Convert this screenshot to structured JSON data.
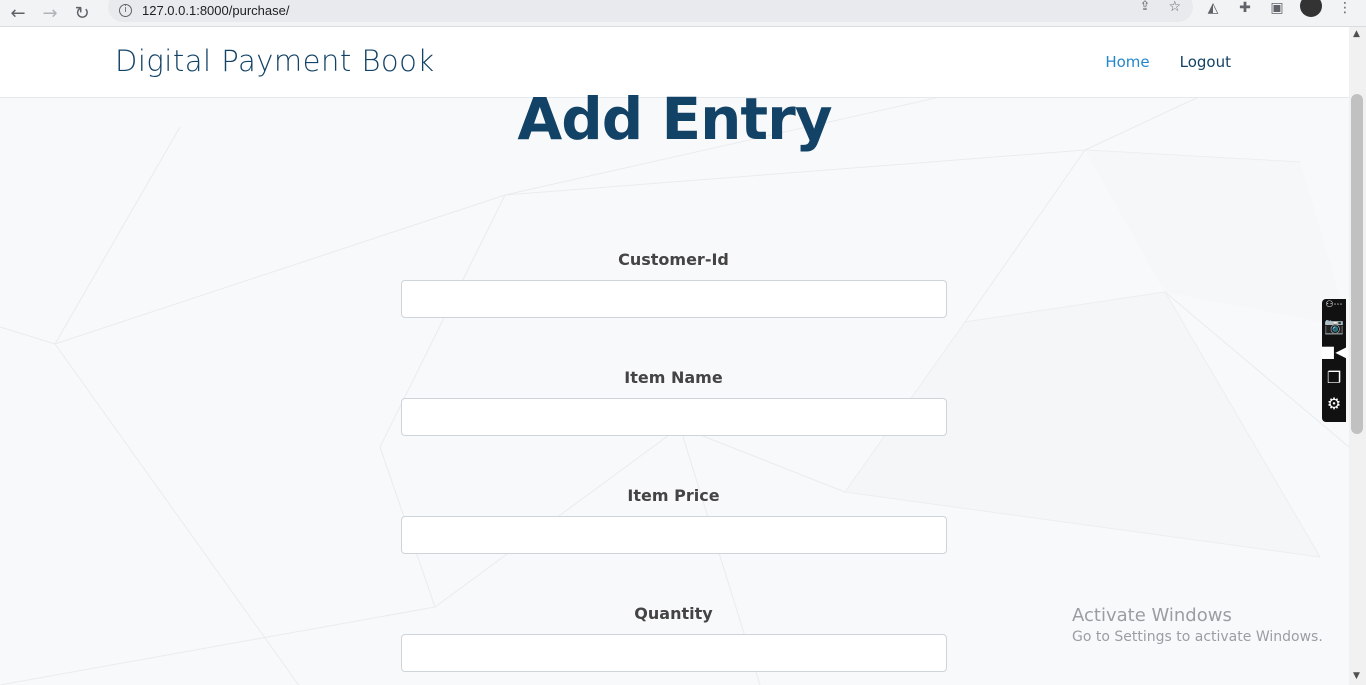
{
  "browser": {
    "url": "127.0.0.1:8000/purchase/"
  },
  "site": {
    "brand": "Digital Payment Book",
    "nav": [
      {
        "label": "Home"
      },
      {
        "label": "Logout"
      }
    ]
  },
  "form": {
    "title": "Add Entry",
    "fields": [
      {
        "label": "Customer-Id",
        "value": ""
      },
      {
        "label": "Item Name",
        "value": ""
      },
      {
        "label": "Item Price",
        "value": ""
      },
      {
        "label": "Quantity",
        "value": ""
      }
    ]
  },
  "watermark": {
    "line1": "Activate Windows",
    "line2": "Go to Settings to activate Windows."
  },
  "colors": {
    "brand": "#124265",
    "accent": "#2487ce"
  }
}
